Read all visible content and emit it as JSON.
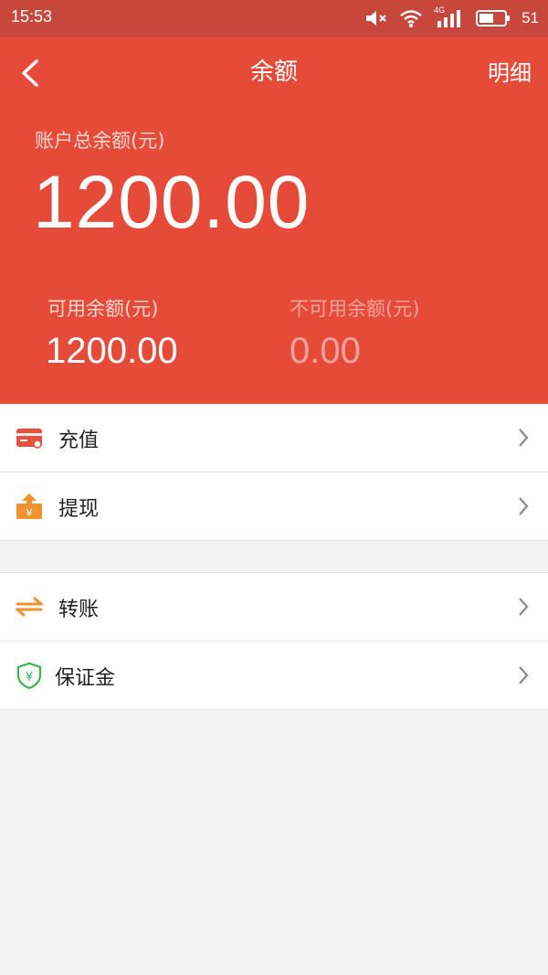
{
  "status_bar": {
    "time": "15:53",
    "battery": "51",
    "network": "4G",
    "icons": [
      "mute-icon",
      "wifi-icon",
      "signal-icon",
      "battery-icon"
    ]
  },
  "nav": {
    "title": "余额",
    "detail_label": "明细"
  },
  "balance": {
    "total_label": "账户总余额(元)",
    "total_value": "1200.00",
    "available_label": "可用余额(元)",
    "available_value": "1200.00",
    "unavailable_label": "不可用余额(元)",
    "unavailable_value": "0.00"
  },
  "menu": {
    "recharge": "充值",
    "withdraw": "提现",
    "transfer": "转账",
    "deposit": "保证金"
  },
  "colors": {
    "header_bg": "#e64b3a",
    "status_bg": "#c8473c",
    "recharge_icon": "#e5533f",
    "withdraw_icon": "#f0922f",
    "transfer_icon": "#f0922f",
    "deposit_icon": "#3cb649"
  }
}
